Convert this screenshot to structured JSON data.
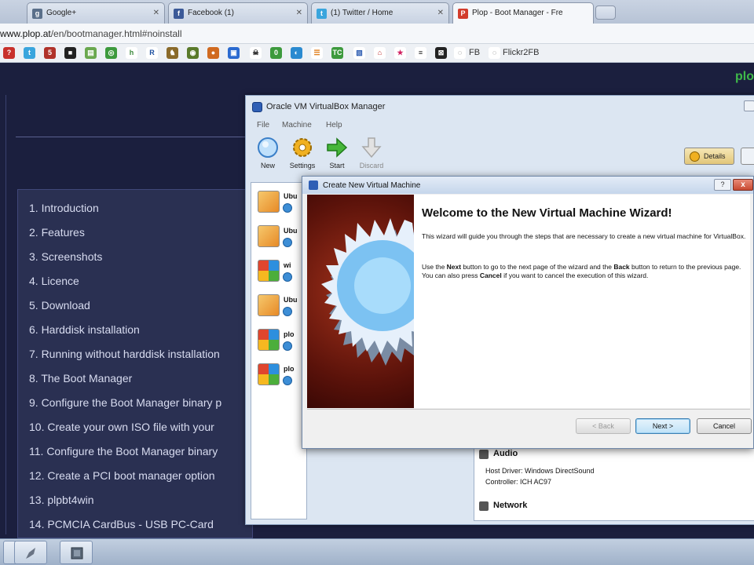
{
  "browser": {
    "tabs": [
      {
        "label": "Google+",
        "icon": "google-plus-icon",
        "color": "#5a6f8a"
      },
      {
        "label": "Facebook (1)",
        "icon": "facebook-icon",
        "color": "#3b5998"
      },
      {
        "label": "(1) Twitter / Home",
        "icon": "twitter-icon",
        "color": "#3aa5dd"
      },
      {
        "label": "Plop - Boot Manager - Fre",
        "icon": "plop-icon",
        "color": "#d23c2c"
      }
    ],
    "url_host": "www.plop.at",
    "url_path": "/en/bootmanager.html#noinstall",
    "bookmarks_text": [
      "FB",
      "Flickr2FB"
    ]
  },
  "page": {
    "logo_text": "plo",
    "menu": [
      "1. Introduction",
      "2. Features",
      "3. Screenshots",
      "4. Licence",
      "5. Download",
      "6. Harddisk installation",
      "7. Running without harddisk installation",
      "8. The Boot Manager",
      "9. Configure the Boot Manager binary p",
      "10. Create your own ISO file with your",
      "11. Configure the Boot Manager binary",
      "12. Create a PCI boot manager option",
      "13. plpbt4win",
      "14. PCMCIA CardBus - USB PC-Card"
    ]
  },
  "vbox": {
    "title": "Oracle VM VirtualBox Manager",
    "menus": [
      "File",
      "Machine",
      "Help"
    ],
    "tools": [
      {
        "label": "New",
        "icon": "new-vm-icon"
      },
      {
        "label": "Settings",
        "icon": "settings-gear-icon"
      },
      {
        "label": "Start",
        "icon": "start-arrow-icon"
      },
      {
        "label": "Discard",
        "icon": "discard-arrow-icon"
      }
    ],
    "details_label": "Details",
    "vms": [
      {
        "name": "Ubu",
        "os": "ubuntu"
      },
      {
        "name": "Ubu",
        "os": "ubuntu"
      },
      {
        "name": "wi",
        "os": "win"
      },
      {
        "name": "Ubu",
        "os": "ubuntu"
      },
      {
        "name": "plo",
        "os": "win"
      },
      {
        "name": "plo",
        "os": "win"
      }
    ],
    "detail": {
      "audio_title": "Audio",
      "host_driver": "Host Driver:  Windows DirectSound",
      "controller": "Controller:   ICH AC97",
      "network_title": "Network"
    }
  },
  "wizard": {
    "title": "Create New Virtual Machine",
    "help": "?",
    "close": "x",
    "heading": "Welcome to the New Virtual Machine Wizard!",
    "para1": "This wizard will guide you through the steps that are necessary to create a new virtual machine for VirtualBox.",
    "para2_a": "Use the ",
    "para2_next": "Next",
    "para2_b": " button to go to the next page of the wizard and the ",
    "para2_back": "Back",
    "para2_c": " button to return to the previous page. You can also press ",
    "para2_cancel": "Cancel",
    "para2_d": " if you want to cancel the execution of this wizard.",
    "back_label": "< Back",
    "next_label": "Next >",
    "cancel_label": "Cancel"
  }
}
